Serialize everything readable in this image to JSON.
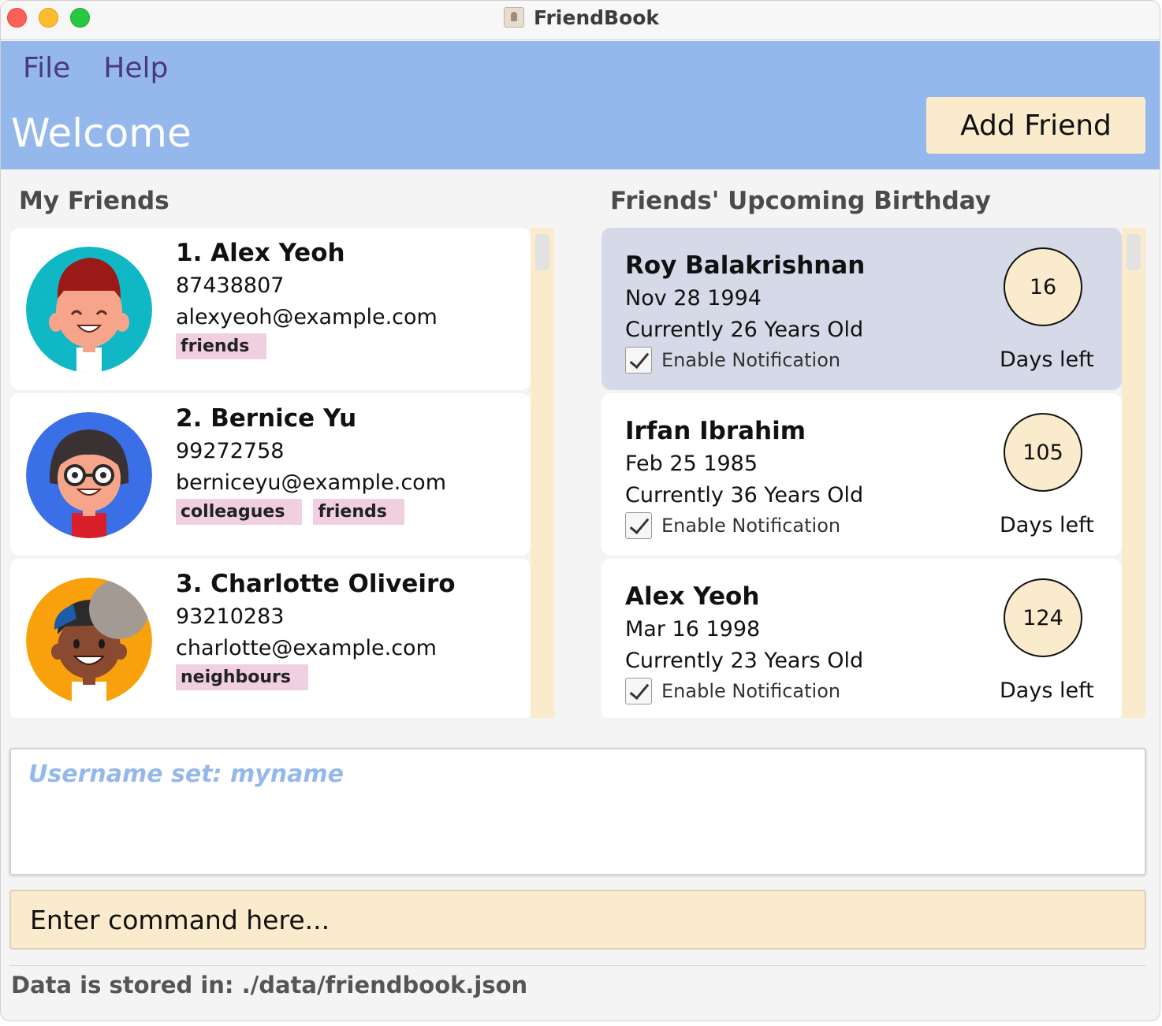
{
  "window": {
    "title": "FriendBook"
  },
  "menu": {
    "file": "File",
    "help": "Help"
  },
  "header": {
    "welcome": "Welcome",
    "add_friend": "Add Friend"
  },
  "friends_section": {
    "title": "My Friends",
    "items": [
      {
        "name": "1. Alex Yeoh",
        "phone": "87438807",
        "email": "alexyeoh@example.com",
        "tags": [
          "friends"
        ],
        "avatar": "boy-red-cap-avatar"
      },
      {
        "name": "2. Bernice Yu",
        "phone": "99272758",
        "email": "berniceyu@example.com",
        "tags": [
          "colleagues",
          "friends"
        ],
        "avatar": "girl-glasses-avatar"
      },
      {
        "name": "3. Charlotte Oliveiro",
        "phone": "93210283",
        "email": "charlotte@example.com",
        "tags": [
          "neighbours"
        ],
        "avatar": "boy-grey-cap-avatar"
      }
    ]
  },
  "birthday_section": {
    "title": "Friends' Upcoming Birthday",
    "items": [
      {
        "name": "Roy Balakrishnan",
        "date": "Nov 28 1994",
        "age": "Currently 26 Years Old",
        "notification": "Enable Notification",
        "days": "16",
        "days_label": "Days left",
        "selected": true
      },
      {
        "name": "Irfan Ibrahim",
        "date": "Feb 25 1985",
        "age": "Currently 36 Years Old",
        "notification": "Enable Notification",
        "days": "105",
        "days_label": "Days left",
        "selected": false
      },
      {
        "name": "Alex Yeoh",
        "date": "Mar 16 1998",
        "age": "Currently 23 Years Old",
        "notification": "Enable Notification",
        "days": "124",
        "days_label": "Days left",
        "selected": false
      }
    ]
  },
  "result": {
    "text": "Username set: myname"
  },
  "command": {
    "placeholder": "Enter command here..."
  },
  "status": {
    "text": "Data is stored in: ./data/friendbook.json"
  },
  "colors": {
    "header": "#95b8ec",
    "accent": "#f9ebcb",
    "tag": "#f0d0e0",
    "selected_card": "#d6d9e8"
  }
}
